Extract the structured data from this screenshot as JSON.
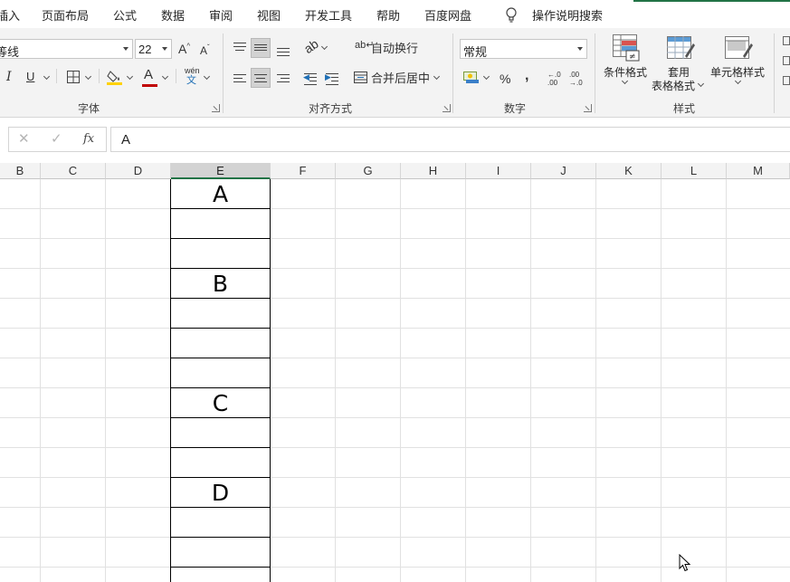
{
  "menu": {
    "tabs": [
      "插入",
      "页面布局",
      "公式",
      "数据",
      "审阅",
      "视图",
      "开发工具",
      "帮助",
      "百度网盘"
    ],
    "tell_me": "操作说明搜索"
  },
  "ribbon": {
    "font": {
      "name_value": "等线",
      "size_value": "22",
      "grow_label": "A",
      "shrink_label": "A",
      "italic_label": "I",
      "underline_label": "U",
      "font_color_label": "A",
      "phonetic_label": "wén",
      "group_label": "字体"
    },
    "alignment": {
      "wrap_text": "自动换行",
      "merge_center": "合并后居中",
      "group_label": "对齐方式"
    },
    "number": {
      "format_value": "常规",
      "percent_label": "%",
      "comma_label": ",",
      "increase_decimal": "←.0 .00",
      "decrease_decimal": ".00 →.0",
      "group_label": "数字"
    },
    "styles": {
      "conditional_format": "条件格式",
      "table_format_line1": "套用",
      "table_format_line2": "表格格式",
      "cell_styles": "单元格样式",
      "group_label": "样式"
    }
  },
  "formula_bar": {
    "fx_label": "fx",
    "value": "A"
  },
  "grid": {
    "columns": [
      "B",
      "C",
      "D",
      "E",
      "F",
      "G",
      "H",
      "I",
      "J",
      "K",
      "L",
      "M"
    ],
    "selected_column": "E",
    "cells": [
      "A",
      "B",
      "C",
      "D"
    ]
  },
  "colors": {
    "accent": "#217346",
    "ribbon_bg": "#f3f3f3",
    "grid_line": "#e1e1e1"
  }
}
